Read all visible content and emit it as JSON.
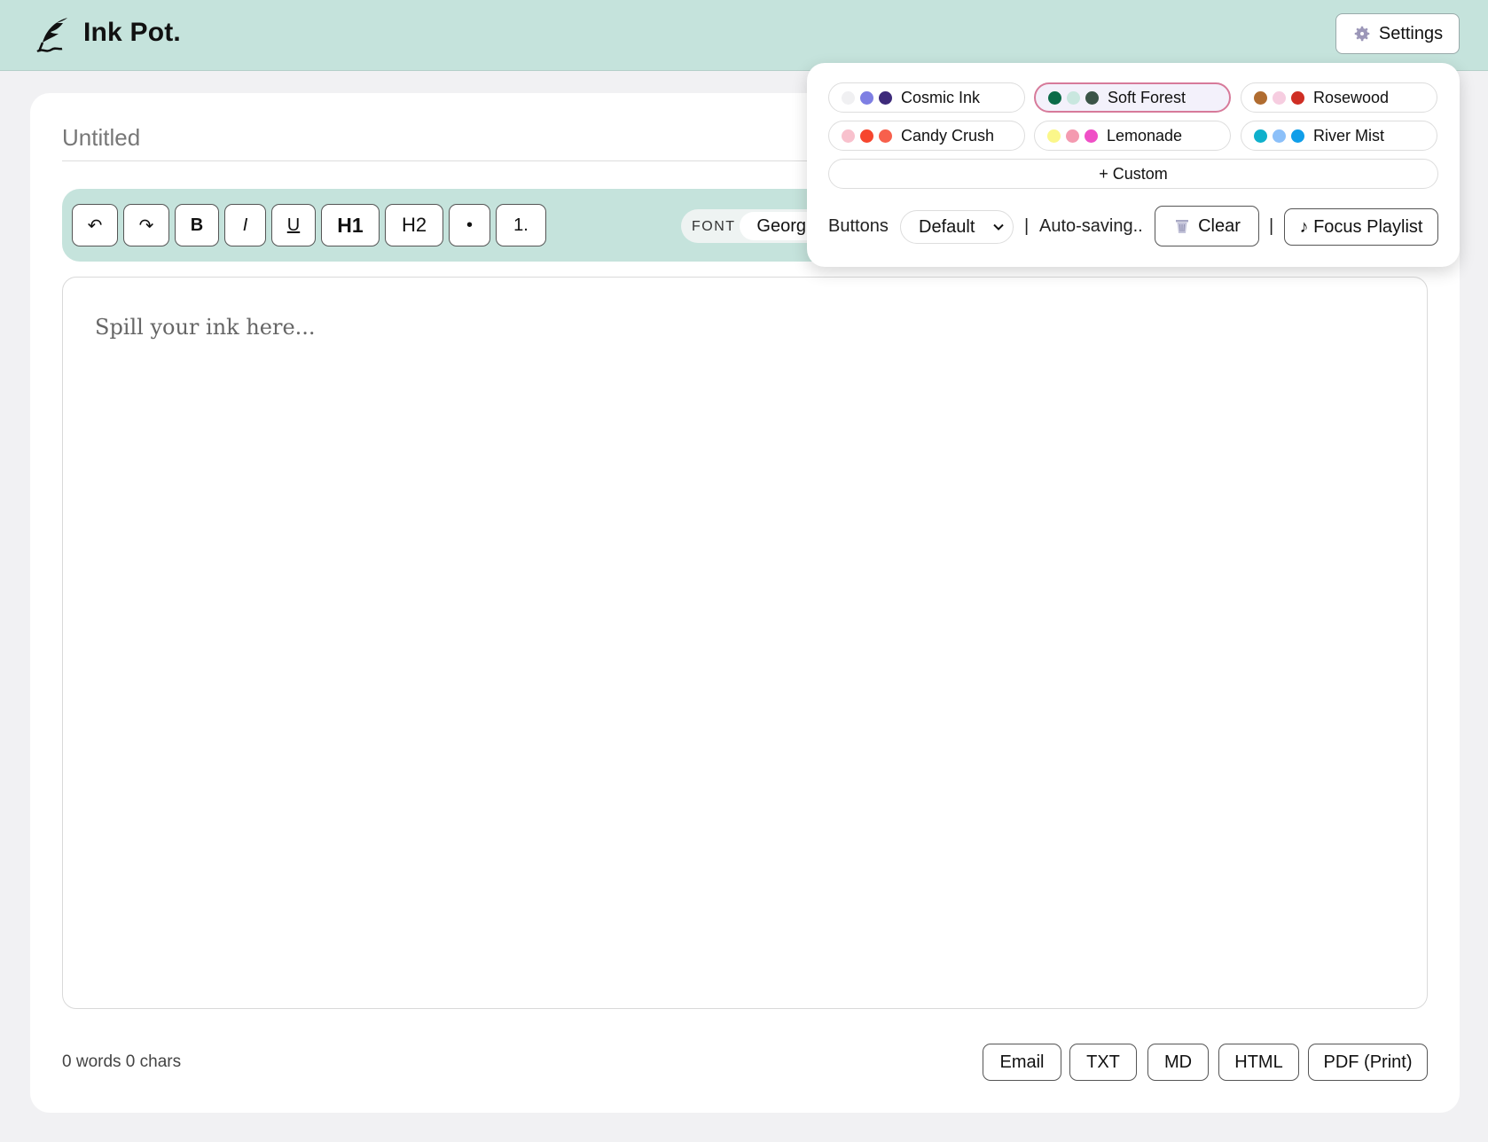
{
  "header": {
    "app_title": "Ink Pot.",
    "settings_label": "Settings"
  },
  "document": {
    "title_placeholder": "Untitled",
    "editor_placeholder": "Spill your ink here..."
  },
  "toolbar": {
    "undo": "↶",
    "redo": "↷",
    "bold": "B",
    "italic": "I",
    "underline": "U",
    "h1": "H1",
    "h2": "H2",
    "bullet": "•",
    "numbered": "1.",
    "font_label": "FONT",
    "font_value": "Georgia"
  },
  "footer": {
    "counts": "0 words 0 chars",
    "exports": [
      "Email",
      "TXT",
      "MD",
      "HTML",
      "PDF (Print)"
    ]
  },
  "settings_panel": {
    "themes": [
      {
        "name": "Cosmic Ink",
        "colors": [
          "#f0f0f2",
          "#7e7fe3",
          "#3d2a7a"
        ],
        "selected": false
      },
      {
        "name": "Soft Forest",
        "colors": [
          "#0b6b48",
          "#c9e7df",
          "#3b5447"
        ],
        "selected": true
      },
      {
        "name": "Rosewood",
        "colors": [
          "#b06c30",
          "#f6cde0",
          "#cf2e24"
        ],
        "selected": false
      },
      {
        "name": "Candy Crush",
        "colors": [
          "#f8c1cd",
          "#f6462e",
          "#f7604c"
        ],
        "selected": false
      },
      {
        "name": "Lemonade",
        "colors": [
          "#fbf78a",
          "#f49ab0",
          "#ef4fc6"
        ],
        "selected": false
      },
      {
        "name": "River Mist",
        "colors": [
          "#0fb0cc",
          "#8cc0f9",
          "#109ee9"
        ],
        "selected": false
      }
    ],
    "custom_label": "+ Custom",
    "buttons_label": "Buttons",
    "buttons_value": "Default",
    "separator": "|",
    "autosave_status": "Auto-saving..",
    "clear_label": "Clear",
    "playlist_label": "♪ Focus Playlist"
  },
  "colors": {
    "accent": "#c5e3dc",
    "selected_border": "#d77a9a"
  }
}
